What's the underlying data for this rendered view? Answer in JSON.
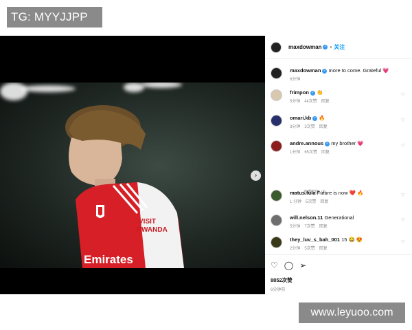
{
  "top_tag": "TG: MYYJJPP",
  "watermark": "www.leyuoo.com",
  "post": {
    "author": "maxdowman",
    "follow_label": "关注",
    "sep": "•",
    "caption_text": "more to come. Grateful 💗",
    "caption_time": "6分钟",
    "kit_text_1": "VISIT",
    "kit_text_2": "RWANDA",
    "kit_text_3": "Emirates"
  },
  "comments": [
    {
      "user": "frimpon",
      "text": "👏",
      "time": "5分钟",
      "likes": "4k次赞",
      "reply": "回复",
      "avatar_color": "#d8c8b0"
    },
    {
      "user": "omari.kb",
      "text": "🔥",
      "time": "3分钟",
      "likes": "3次赞",
      "reply": "回复",
      "avatar_color": "#27306b"
    },
    {
      "user": "andre.annous",
      "text": "my brother 💗",
      "time": "1分钟",
      "likes": "65次赞",
      "reply": "回复",
      "avatar_color": "#8b1d1d"
    },
    {
      "user": "matus.fula",
      "text": "Future is now ❤️ 🔥",
      "time": "1 分钟",
      "likes": "5次赞",
      "reply": "回复",
      "avatar_color": "#3b5a2e"
    },
    {
      "user": "will.nelson.11",
      "text": "Generational",
      "time": "5分钟",
      "likes": "7次赞",
      "reply": "回复",
      "avatar_color": "#6e6e6e"
    },
    {
      "user": "they_luv_s_bah_001",
      "text": "15 😂 😍",
      "time": "2分钟",
      "likes": "5次赞",
      "reply": "回复",
      "avatar_color": "#3a3a1a"
    }
  ],
  "view_replies": "查看回复 (3)",
  "likes_count": "8852次赞",
  "posted_time": "6分钟前",
  "icons": {
    "like": "heart-icon",
    "comment": "comment-icon",
    "share": "share-icon",
    "next": "chevron-right-icon"
  }
}
